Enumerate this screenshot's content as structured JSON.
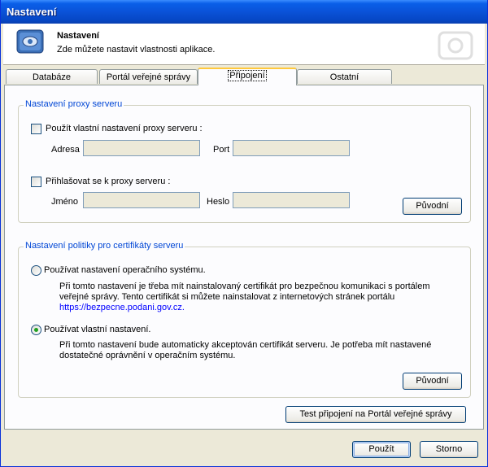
{
  "window": {
    "title": "Nastavení"
  },
  "header": {
    "title": "Nastavení",
    "subtitle": "Zde můžete nastavit vlastnosti aplikace."
  },
  "tabs": [
    {
      "label": "Databáze"
    },
    {
      "label": "Portál veřejné správy"
    },
    {
      "label": "Připojení"
    },
    {
      "label": "Ostatní"
    }
  ],
  "proxy": {
    "group_title": "Nastavení proxy serveru",
    "use_custom_label": "Použít vlastní nastavení proxy serveru :",
    "address_label": "Adresa",
    "address_value": "",
    "port_label": "Port",
    "port_value": "",
    "login_label": "Přihlašovat se k proxy serveru :",
    "name_label": "Jméno",
    "name_value": "",
    "password_label": "Heslo",
    "password_value": "",
    "default_button": "Původní"
  },
  "certs": {
    "group_title": "Nastavení politiky pro certifikáty serveru",
    "os_option_label": "Používat nastavení operačního systému.",
    "os_desc_line1": "Při tomto nastavení je třeba mít nainstalovaný certifikát pro bezpečnou komunikaci s portálem",
    "os_desc_line2": "veřejné správy.  Tento certifikát si můžete nainstalovat z internetových stránek portálu",
    "os_desc_link": "https://bezpecne.podani.gov.cz.",
    "custom_option_label": "Používat vlastní nastavení.",
    "custom_desc_line1": "Při tomto nastavení bude automaticky akceptován certifikát serveru. Je potřeba mít nastavené",
    "custom_desc_line2": "dostatečné oprávnění v operačním systému.",
    "default_button": "Původní"
  },
  "test_button": "Test připojení na Portál veřejné správy",
  "footer": {
    "apply_button": "Použít",
    "cancel_button": "Storno"
  },
  "colors": {
    "accent": "#0046d5",
    "titlebar": "#0a52d8",
    "tab_highlight": "#ffc83c"
  }
}
